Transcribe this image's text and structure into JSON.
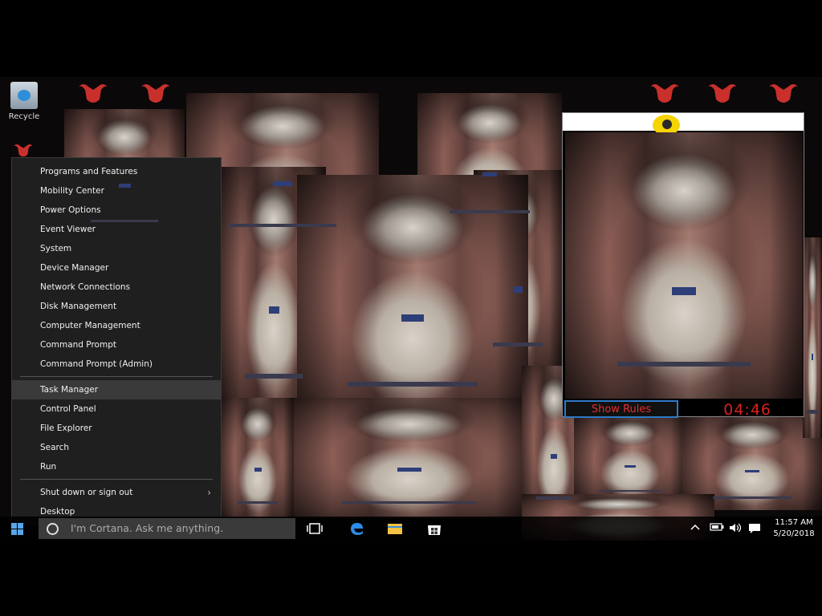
{
  "desktop": {
    "recycle_label": "Recycle"
  },
  "winx_menu": {
    "items": [
      {
        "label": "Programs and Features"
      },
      {
        "label": "Mobility Center"
      },
      {
        "label": "Power Options"
      },
      {
        "label": "Event Viewer"
      },
      {
        "label": "System"
      },
      {
        "label": "Device Manager"
      },
      {
        "label": "Network Connections"
      },
      {
        "label": "Disk Management"
      },
      {
        "label": "Computer Management"
      },
      {
        "label": "Command Prompt"
      },
      {
        "label": "Command Prompt (Admin)"
      },
      {
        "label": "Task Manager"
      },
      {
        "label": "Control Panel"
      },
      {
        "label": "File Explorer"
      },
      {
        "label": "Search"
      },
      {
        "label": "Run"
      },
      {
        "label": "Shut down or sign out"
      },
      {
        "label": "Desktop"
      }
    ],
    "submenu_arrow": "›"
  },
  "rules_window": {
    "button_label": "Show Rules",
    "timer": "04:46"
  },
  "taskbar": {
    "search_placeholder": "I'm Cortana. Ask me anything.",
    "time": "11:57 AM",
    "date": "5/20/2018"
  },
  "colors": {
    "taskbar_bg": "#000000",
    "menu_bg": "#1f1f1f",
    "menu_highlight": "#3a3a3a",
    "timer_red": "#d82020",
    "button_border": "#2d79c7",
    "start_blue": "#5aa6ea"
  }
}
